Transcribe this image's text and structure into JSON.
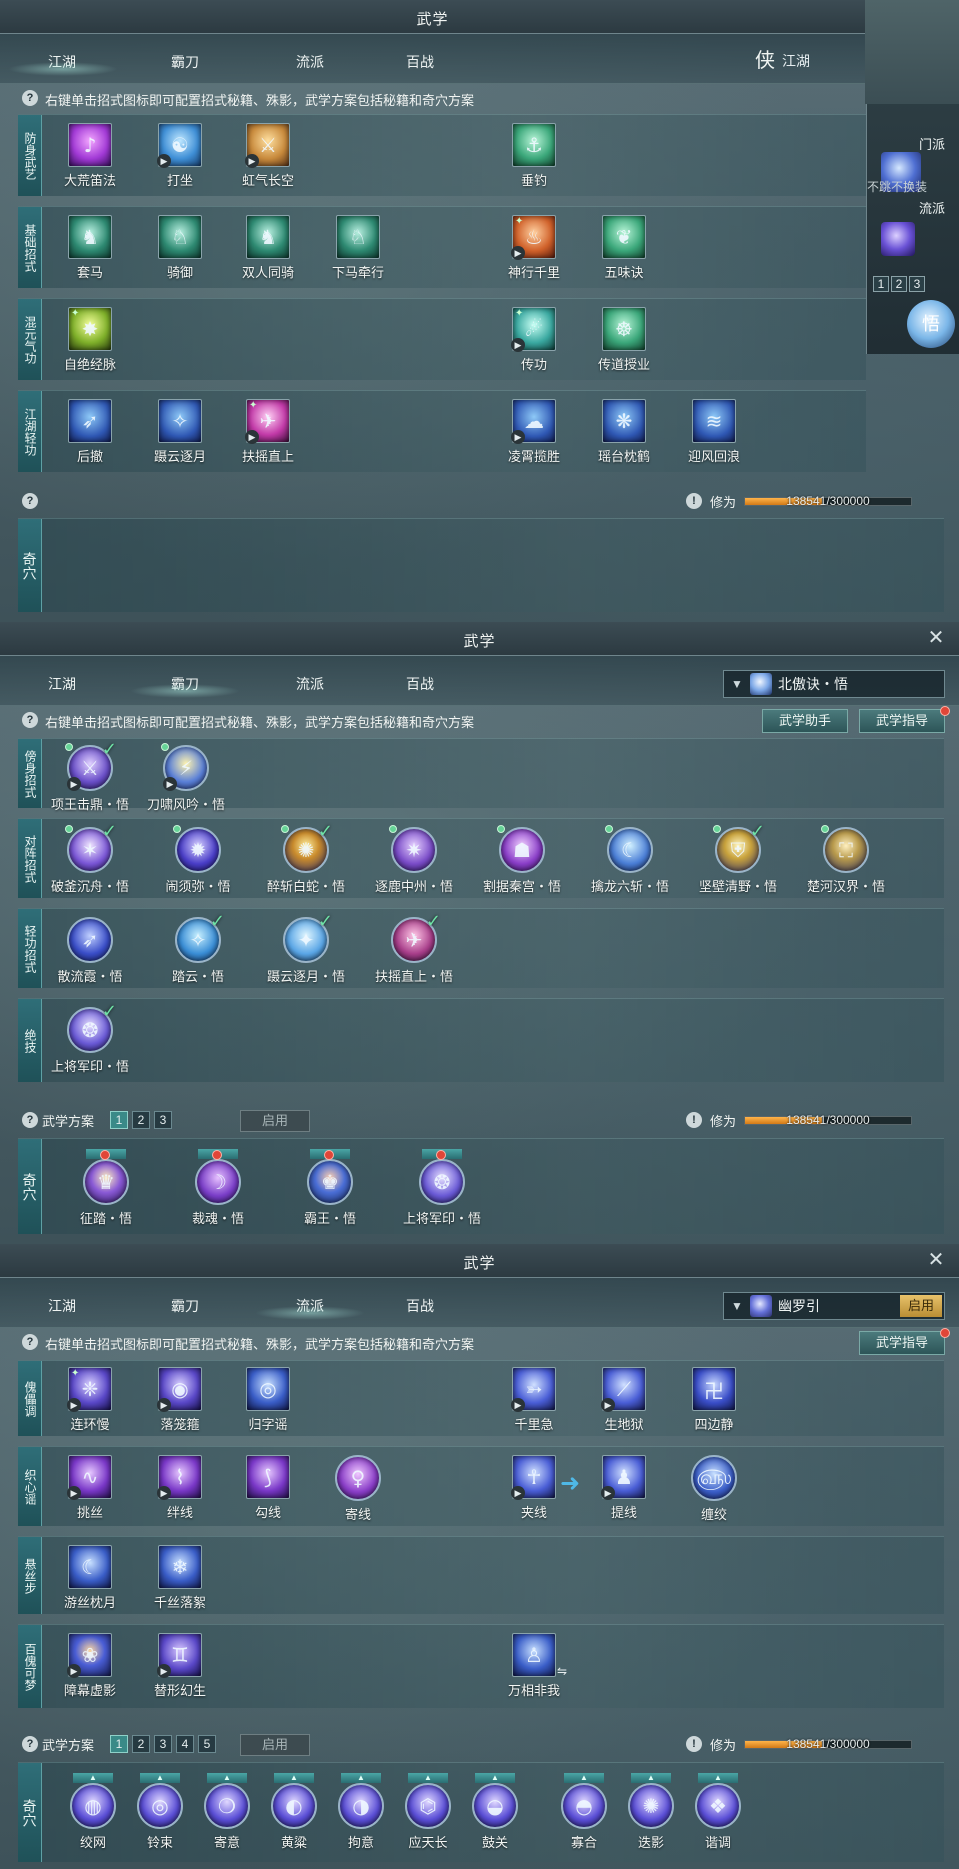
{
  "panels": [
    {
      "title": "武学",
      "tabs": [
        "江湖",
        "霸刀",
        "流派",
        "百战"
      ],
      "active_tab": 0,
      "right_tab": {
        "emblem": "侠",
        "label": "江湖"
      },
      "hint": "右键单击招式图标即可配置招式秘籍、殊影，武学方案包括秘籍和奇穴方案",
      "sections": [
        {
          "label": "防身武艺",
          "skills": [
            "大荒笛法",
            "打坐",
            "虹气长空",
            "垂钓"
          ]
        },
        {
          "label": "基础招式",
          "skills": [
            "套马",
            "骑御",
            "双人同骑",
            "下马牵行",
            "神行千里",
            "五味诀"
          ]
        },
        {
          "label": "混元气功",
          "skills": [
            "自绝经脉",
            "传功",
            "传道授业"
          ]
        },
        {
          "label": "江湖轻功",
          "skills": [
            "后撤",
            "蹑云逐月",
            "扶摇直上",
            "凌霄揽胜",
            "瑶台枕鹤",
            "迎风回浪"
          ]
        }
      ],
      "cultivation_label": "修为",
      "cultivation_text": "138541/300000",
      "cultivation_fraction": 0.4618,
      "qixue_label": "奇穴",
      "side_widget": {
        "menpai": "门派",
        "liupai": "流派",
        "note": "不跳不换装",
        "nums": [
          "1",
          "2",
          "3"
        ],
        "emblem": "悟"
      }
    },
    {
      "title": "武学",
      "tabs": [
        "江湖",
        "霸刀",
        "流派",
        "百战"
      ],
      "active_tab": 1,
      "school": "北傲诀・悟",
      "hint": "右键单击招式图标即可配置招式秘籍、殊影，武学方案包括秘籍和奇穴方案",
      "buttons": [
        "武学助手",
        "武学指导"
      ],
      "sections": [
        {
          "label": "傍身招式",
          "skills": [
            "项王击鼎・悟",
            "刀啸风吟・悟"
          ]
        },
        {
          "label": "对阵招式",
          "skills": [
            "破釜沉舟・悟",
            "闹须弥・悟",
            "醉斩白蛇・悟",
            "逐鹿中州・悟",
            "割据秦宫・悟",
            "擒龙六斩・悟",
            "坚壁清野・悟",
            "楚河汉界・悟"
          ]
        },
        {
          "label": "轻功招式",
          "skills": [
            "散流霞・悟",
            "踏云・悟",
            "蹑云逐月・悟",
            "扶摇直上・悟"
          ]
        },
        {
          "label": "绝技",
          "skills": [
            "上将军印・悟"
          ]
        }
      ],
      "plan_label": "武学方案",
      "plans": [
        "1",
        "2",
        "3"
      ],
      "enable_label": "启用",
      "cultivation_label": "修为",
      "cultivation_text": "138541/300000",
      "cultivation_fraction": 0.4618,
      "qixue_label": "奇穴",
      "qixue": [
        "征踏・悟",
        "裁魂・悟",
        "霸王・悟",
        "上将军印・悟"
      ]
    },
    {
      "title": "武学",
      "tabs": [
        "江湖",
        "霸刀",
        "流派",
        "百战"
      ],
      "active_tab": 2,
      "school": "幽罗引",
      "school_enable": "启用",
      "hint": "右键单击招式图标即可配置招式秘籍、殊影，武学方案包括秘籍和奇穴方案",
      "buttons": [
        "武学指导"
      ],
      "sections": [
        {
          "label": "傀儡调",
          "skills": [
            "连环慢",
            "落笼箍",
            "归字谣",
            "千里急",
            "生地狱",
            "四边静"
          ]
        },
        {
          "label": "织心谣",
          "skills": [
            "挑丝",
            "绊线",
            "勾线",
            "寄线",
            "夹线",
            "提线",
            "缠绞"
          ]
        },
        {
          "label": "悬丝步",
          "skills": [
            "游丝枕月",
            "千丝落絮"
          ]
        },
        {
          "label": "百傀可梦",
          "skills": [
            "障幕虚影",
            "替形幻生",
            "万相非我"
          ]
        }
      ],
      "plan_label": "武学方案",
      "plans": [
        "1",
        "2",
        "3",
        "4",
        "5"
      ],
      "enable_label": "启用",
      "cultivation_label": "修为",
      "cultivation_text": "138541/300000",
      "cultivation_fraction": 0.4618,
      "qixue_label": "奇穴",
      "qixue": [
        "绞网",
        "铃束",
        "寄意",
        "黄粱",
        "拘意",
        "应天长",
        "鼓关",
        "寡合",
        "迭影",
        "谐调"
      ]
    }
  ],
  "colors": {
    "accent": "#2f6e78",
    "progress": "#e89a2c",
    "alert": "#e04638",
    "enable": "#d2a447"
  }
}
